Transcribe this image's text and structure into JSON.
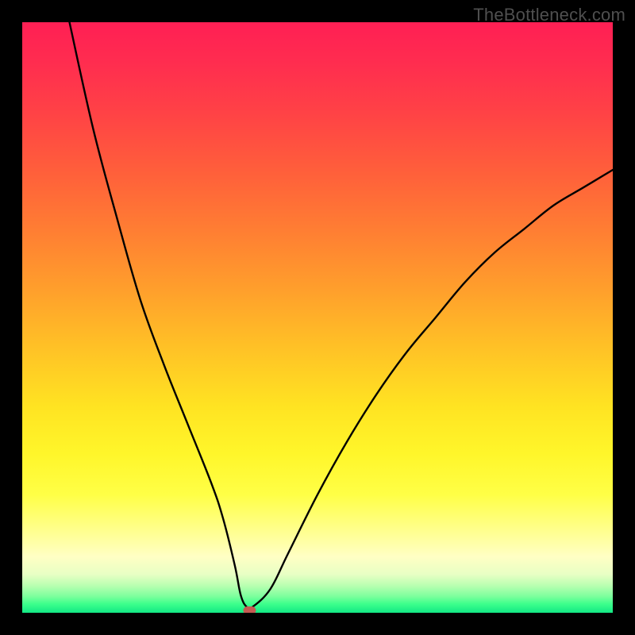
{
  "watermark": "TheBottleneck.com",
  "chart_data": {
    "type": "line",
    "title": "",
    "xlabel": "",
    "ylabel": "",
    "xlim": [
      0,
      100
    ],
    "ylim": [
      0,
      100
    ],
    "grid": false,
    "legend": false,
    "series": [
      {
        "name": "curve",
        "x": [
          8,
          12,
          16,
          20,
          24,
          28,
          32,
          34,
          36,
          37,
          38,
          39,
          42,
          45,
          50,
          55,
          60,
          65,
          70,
          75,
          80,
          85,
          90,
          95,
          100
        ],
        "values": [
          100,
          82,
          67,
          53,
          42,
          32,
          22,
          16,
          8,
          3,
          1,
          1,
          4,
          10,
          20,
          29,
          37,
          44,
          50,
          56,
          61,
          65,
          69,
          72,
          75
        ]
      }
    ],
    "marker": {
      "name": "bottleneck-point",
      "x": 38.5,
      "y": 0,
      "color": "#c55a52"
    },
    "gradient_stops": [
      {
        "offset": 0.0,
        "color": "#ff1f54"
      },
      {
        "offset": 0.07,
        "color": "#ff2d4f"
      },
      {
        "offset": 0.15,
        "color": "#ff4146"
      },
      {
        "offset": 0.25,
        "color": "#ff5e3b"
      },
      {
        "offset": 0.35,
        "color": "#ff7d33"
      },
      {
        "offset": 0.45,
        "color": "#ff9e2c"
      },
      {
        "offset": 0.55,
        "color": "#ffc126"
      },
      {
        "offset": 0.65,
        "color": "#ffe322"
      },
      {
        "offset": 0.73,
        "color": "#fff62a"
      },
      {
        "offset": 0.8,
        "color": "#ffff46"
      },
      {
        "offset": 0.86,
        "color": "#ffff8d"
      },
      {
        "offset": 0.905,
        "color": "#ffffc4"
      },
      {
        "offset": 0.935,
        "color": "#e8ffc4"
      },
      {
        "offset": 0.955,
        "color": "#b6ffb0"
      },
      {
        "offset": 0.972,
        "color": "#7dff9d"
      },
      {
        "offset": 0.985,
        "color": "#3dff8c"
      },
      {
        "offset": 1.0,
        "color": "#12e884"
      }
    ]
  }
}
